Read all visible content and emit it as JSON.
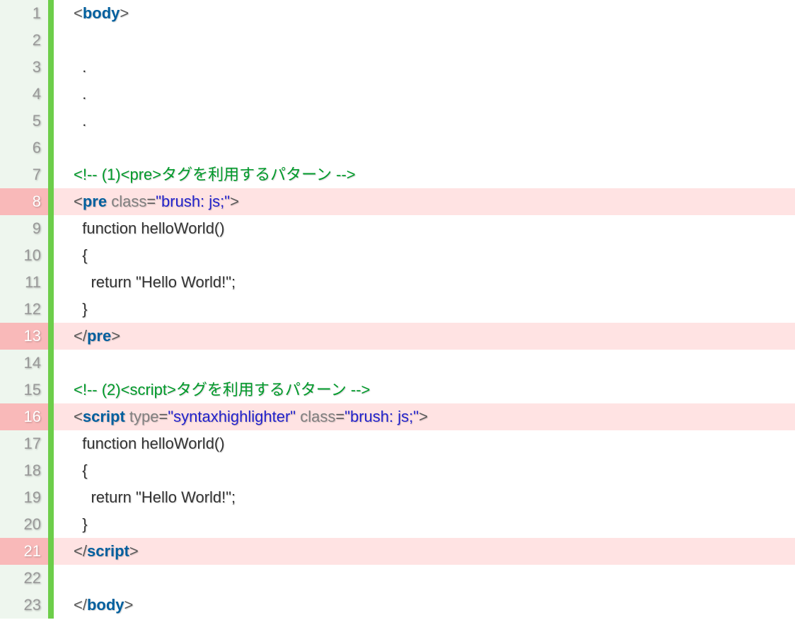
{
  "lines": [
    {
      "num": 1,
      "hl": false,
      "tokens": [
        {
          "t": "punct",
          "v": "<"
        },
        {
          "t": "tagname",
          "v": "body"
        },
        {
          "t": "punct",
          "v": ">"
        }
      ]
    },
    {
      "num": 2,
      "hl": false,
      "tokens": []
    },
    {
      "num": 3,
      "hl": false,
      "tokens": [
        {
          "t": "plain",
          "v": "  ."
        }
      ]
    },
    {
      "num": 4,
      "hl": false,
      "tokens": [
        {
          "t": "plain",
          "v": "  ."
        }
      ]
    },
    {
      "num": 5,
      "hl": false,
      "tokens": [
        {
          "t": "plain",
          "v": "  ."
        }
      ]
    },
    {
      "num": 6,
      "hl": false,
      "tokens": []
    },
    {
      "num": 7,
      "hl": false,
      "tokens": [
        {
          "t": "comment",
          "v": "<!-- (1)<pre>タグを利用するパターン -->"
        }
      ]
    },
    {
      "num": 8,
      "hl": true,
      "tokens": [
        {
          "t": "punct",
          "v": "<"
        },
        {
          "t": "tagname",
          "v": "pre"
        },
        {
          "t": "plain",
          "v": " "
        },
        {
          "t": "attr",
          "v": "class"
        },
        {
          "t": "punct",
          "v": "="
        },
        {
          "t": "string",
          "v": "\"brush: js;\""
        },
        {
          "t": "punct",
          "v": ">"
        }
      ]
    },
    {
      "num": 9,
      "hl": false,
      "tokens": [
        {
          "t": "plain",
          "v": "  function helloWorld()"
        }
      ]
    },
    {
      "num": 10,
      "hl": false,
      "tokens": [
        {
          "t": "plain",
          "v": "  {"
        }
      ]
    },
    {
      "num": 11,
      "hl": false,
      "tokens": [
        {
          "t": "plain",
          "v": "    return \"Hello World!\";"
        }
      ]
    },
    {
      "num": 12,
      "hl": false,
      "tokens": [
        {
          "t": "plain",
          "v": "  }"
        }
      ]
    },
    {
      "num": 13,
      "hl": true,
      "tokens": [
        {
          "t": "punct",
          "v": "</"
        },
        {
          "t": "tagname",
          "v": "pre"
        },
        {
          "t": "punct",
          "v": ">"
        }
      ]
    },
    {
      "num": 14,
      "hl": false,
      "tokens": []
    },
    {
      "num": 15,
      "hl": false,
      "tokens": [
        {
          "t": "comment",
          "v": "<!-- (2)<script>タグを利用するパターン -->"
        }
      ]
    },
    {
      "num": 16,
      "hl": true,
      "tokens": [
        {
          "t": "punct",
          "v": "<"
        },
        {
          "t": "tagname",
          "v": "script"
        },
        {
          "t": "plain",
          "v": " "
        },
        {
          "t": "attr",
          "v": "type"
        },
        {
          "t": "punct",
          "v": "="
        },
        {
          "t": "string",
          "v": "\"syntaxhighlighter\""
        },
        {
          "t": "plain",
          "v": " "
        },
        {
          "t": "attr",
          "v": "class"
        },
        {
          "t": "punct",
          "v": "="
        },
        {
          "t": "string",
          "v": "\"brush: js;\""
        },
        {
          "t": "punct",
          "v": ">"
        }
      ]
    },
    {
      "num": 17,
      "hl": false,
      "tokens": [
        {
          "t": "plain",
          "v": "  function helloWorld()"
        }
      ]
    },
    {
      "num": 18,
      "hl": false,
      "tokens": [
        {
          "t": "plain",
          "v": "  {"
        }
      ]
    },
    {
      "num": 19,
      "hl": false,
      "tokens": [
        {
          "t": "plain",
          "v": "    return \"Hello World!\";"
        }
      ]
    },
    {
      "num": 20,
      "hl": false,
      "tokens": [
        {
          "t": "plain",
          "v": "  }"
        }
      ]
    },
    {
      "num": 21,
      "hl": true,
      "tokens": [
        {
          "t": "punct",
          "v": "</"
        },
        {
          "t": "tagname",
          "v": "script"
        },
        {
          "t": "punct",
          "v": ">"
        }
      ]
    },
    {
      "num": 22,
      "hl": false,
      "tokens": []
    },
    {
      "num": 23,
      "hl": false,
      "tokens": [
        {
          "t": "punct",
          "v": "</"
        },
        {
          "t": "tagname",
          "v": "body"
        },
        {
          "t": "punct",
          "v": ">"
        }
      ]
    }
  ]
}
